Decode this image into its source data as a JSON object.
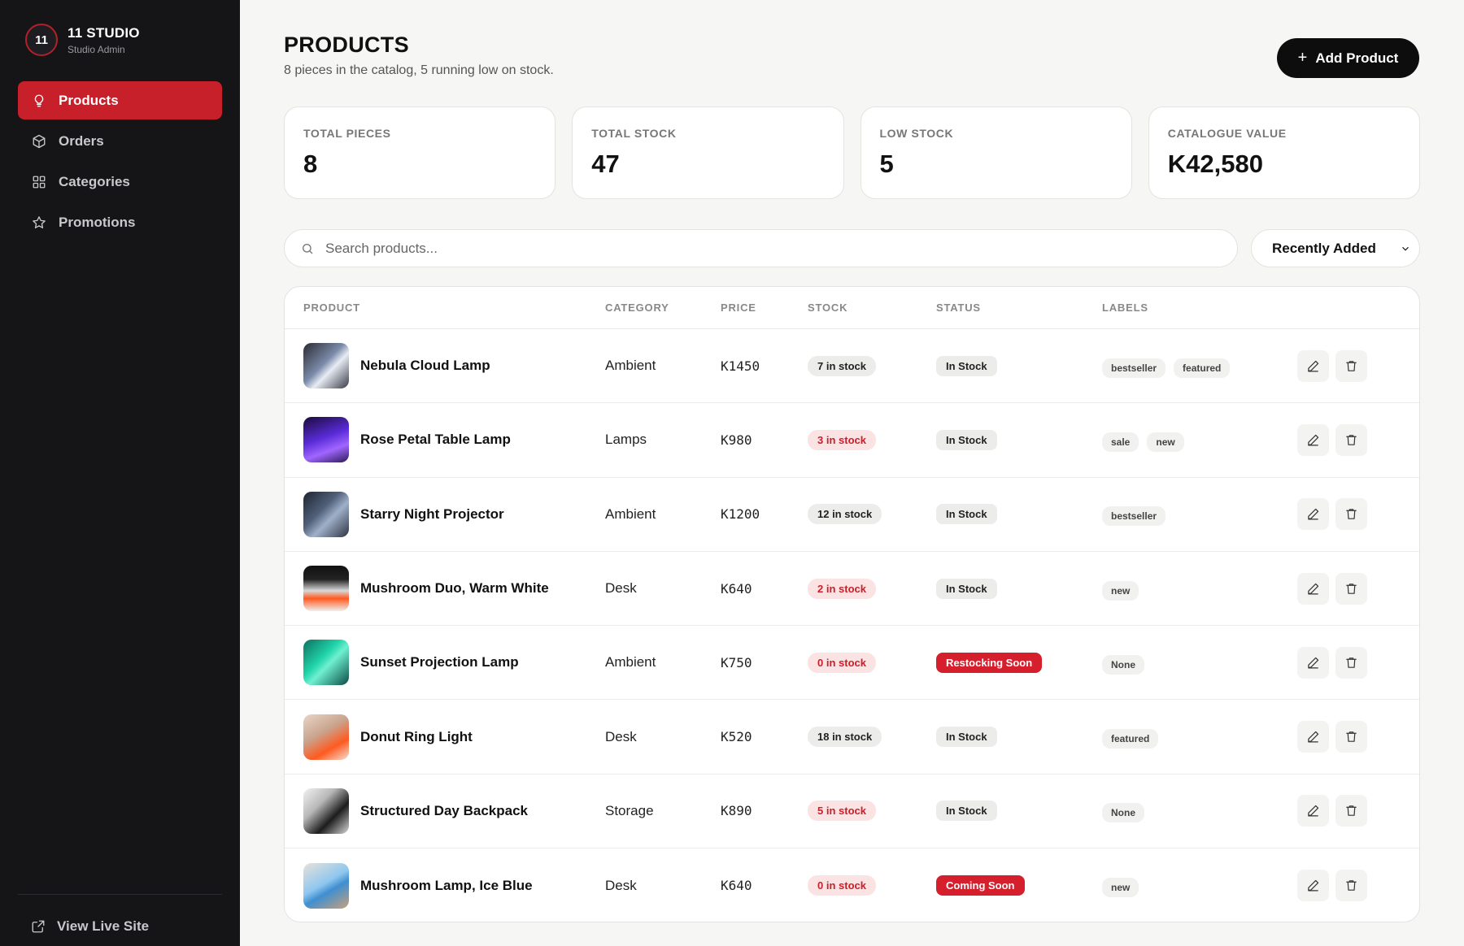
{
  "brand": {
    "logo_text": "11",
    "name": "11 STUDIO",
    "subtitle": "Studio Admin"
  },
  "sidebar": {
    "items": [
      {
        "label": "Products",
        "icon": "lightbulb-icon",
        "active": true
      },
      {
        "label": "Orders",
        "icon": "box-icon",
        "active": false
      },
      {
        "label": "Categories",
        "icon": "grid-icon",
        "active": false
      },
      {
        "label": "Promotions",
        "icon": "star-icon",
        "active": false
      }
    ],
    "footer_link": "View Live Site"
  },
  "header": {
    "title": "PRODUCTS",
    "subtitle": "8 pieces in the catalog, 5 running low on stock.",
    "add_button": "Add Product"
  },
  "stats": [
    {
      "label": "TOTAL PIECES",
      "value": "8"
    },
    {
      "label": "TOTAL STOCK",
      "value": "47"
    },
    {
      "label": "LOW STOCK",
      "value": "5"
    },
    {
      "label": "CATALOGUE VALUE",
      "value": "K42,580"
    }
  ],
  "search": {
    "placeholder": "Search products...",
    "value": ""
  },
  "sort": {
    "selected": "Recently Added"
  },
  "table": {
    "columns": [
      "PRODUCT",
      "CATEGORY",
      "PRICE",
      "STOCK",
      "STATUS",
      "LABELS"
    ],
    "rows": [
      {
        "name": "Nebula Cloud Lamp",
        "category": "Ambient",
        "price": "K1450",
        "stock": "7 in stock",
        "stock_low": false,
        "status": "In Stock",
        "status_alert": false,
        "labels": [
          "bestseller",
          "featured"
        ]
      },
      {
        "name": "Rose Petal Table Lamp",
        "category": "Lamps",
        "price": "K980",
        "stock": "3 in stock",
        "stock_low": true,
        "status": "In Stock",
        "status_alert": false,
        "labels": [
          "sale",
          "new"
        ]
      },
      {
        "name": "Starry Night Projector",
        "category": "Ambient",
        "price": "K1200",
        "stock": "12 in stock",
        "stock_low": false,
        "status": "In Stock",
        "status_alert": false,
        "labels": [
          "bestseller"
        ]
      },
      {
        "name": "Mushroom Duo, Warm White",
        "category": "Desk",
        "price": "K640",
        "stock": "2 in stock",
        "stock_low": true,
        "status": "In Stock",
        "status_alert": false,
        "labels": [
          "new"
        ]
      },
      {
        "name": "Sunset Projection Lamp",
        "category": "Ambient",
        "price": "K750",
        "stock": "0 in stock",
        "stock_low": true,
        "status": "Restocking Soon",
        "status_alert": true,
        "labels": [
          "None"
        ]
      },
      {
        "name": "Donut Ring Light",
        "category": "Desk",
        "price": "K520",
        "stock": "18 in stock",
        "stock_low": false,
        "status": "In Stock",
        "status_alert": false,
        "labels": [
          "featured"
        ]
      },
      {
        "name": "Structured Day Backpack",
        "category": "Storage",
        "price": "K890",
        "stock": "5 in stock",
        "stock_low": true,
        "status": "In Stock",
        "status_alert": false,
        "labels": [
          "None"
        ]
      },
      {
        "name": "Mushroom Lamp, Ice Blue",
        "category": "Desk",
        "price": "K640",
        "stock": "0 in stock",
        "stock_low": true,
        "status": "Coming Soon",
        "status_alert": true,
        "labels": [
          "new"
        ]
      }
    ]
  },
  "colors": {
    "accent": "#c8202b",
    "sidebar_bg": "#151517",
    "alert": "#d61f2c"
  }
}
